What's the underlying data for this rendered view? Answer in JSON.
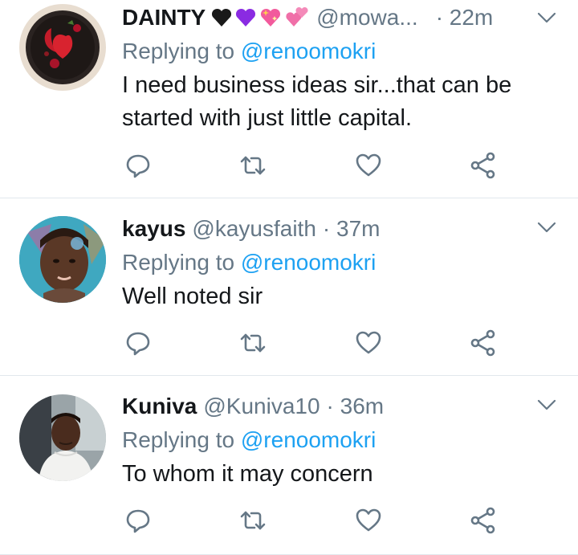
{
  "tweets": [
    {
      "name": "DAINTY",
      "emojis": [
        "black-heart",
        "purple-heart",
        "sparkling-heart",
        "revolving-hearts"
      ],
      "handle": "@mowa...",
      "time": "· 22m",
      "replying_prefix": "Replying to ",
      "replying_to": "@renoomokri",
      "text": "I need business ideas sir...that can be started with just little capital."
    },
    {
      "name": "kayus",
      "handle": "@kayusfaith",
      "time": "· 37m",
      "replying_prefix": "Replying to ",
      "replying_to": "@renoomokri",
      "text": "Well noted sir"
    },
    {
      "name": "Kuniva",
      "handle": "@Kuniva10",
      "time": "· 36m",
      "replying_prefix": "Replying to ",
      "replying_to": "@renoomokri",
      "text": "To whom it may concern"
    }
  ],
  "icons": {
    "reply": "reply-icon",
    "retweet": "retweet-icon",
    "like": "like-icon",
    "share": "share-icon",
    "menu": "chevron-down-icon"
  },
  "colors": {
    "text": "#14171a",
    "secondary": "#657786",
    "mention": "#1da1f2",
    "divider": "#e1e8ed"
  }
}
